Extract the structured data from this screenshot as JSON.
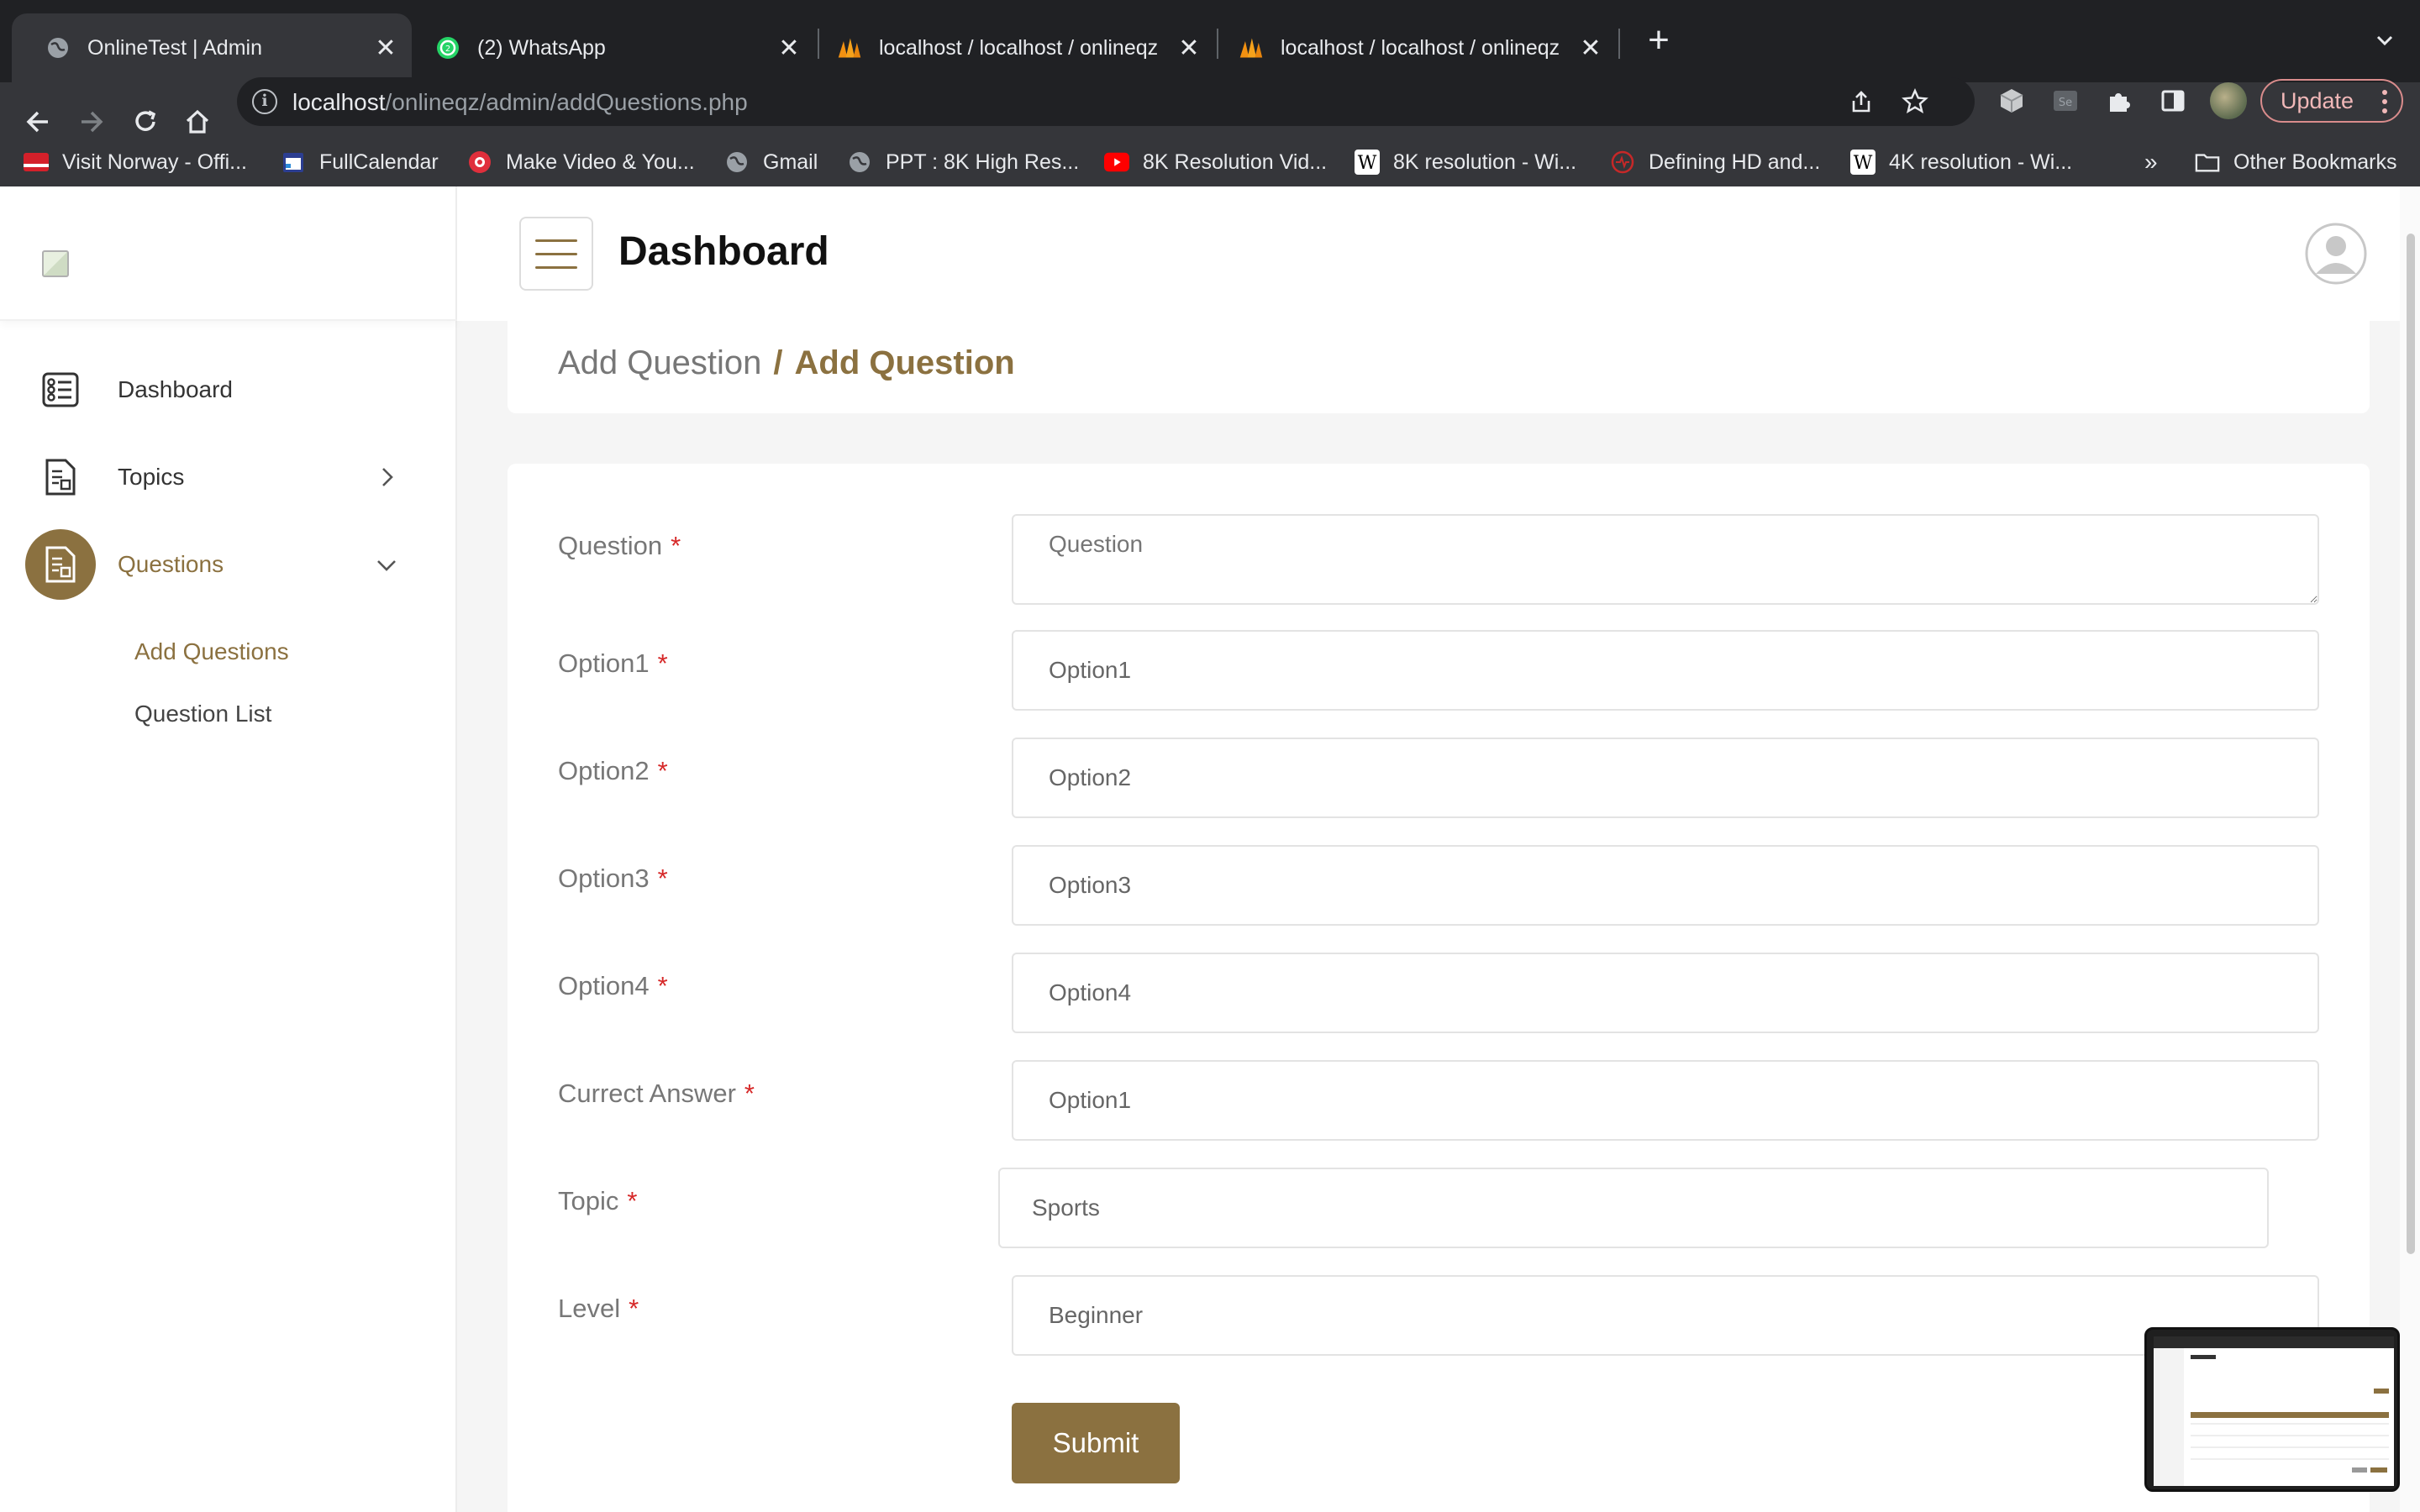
{
  "browser": {
    "tabs": [
      {
        "title": "OnlineTest | Admin",
        "icon": "globe-icon",
        "active": true
      },
      {
        "title": "(2) WhatsApp",
        "icon": "whatsapp-icon",
        "active": false
      },
      {
        "title": "localhost / localhost / onlineqz",
        "icon": "phpmyadmin-icon",
        "active": false
      },
      {
        "title": "localhost / localhost / onlineqz",
        "icon": "phpmyadmin-icon",
        "active": false
      }
    ],
    "url_host": "localhost",
    "url_path": "/onlineqz/admin/addQuestions.php",
    "update_label": "Update",
    "bookmarks": [
      {
        "label": "Visit Norway - Offi...",
        "icon": "norway-flag-icon"
      },
      {
        "label": "FullCalendar",
        "icon": "calendar-icon"
      },
      {
        "label": "Make Video & You...",
        "icon": "video-maker-icon"
      },
      {
        "label": "Gmail",
        "icon": "globe-icon"
      },
      {
        "label": "PPT : 8K High Res...",
        "icon": "globe-icon"
      },
      {
        "label": "8K Resolution Vid...",
        "icon": "youtube-icon"
      },
      {
        "label": "8K resolution - Wi...",
        "icon": "wikipedia-icon"
      },
      {
        "label": "Defining HD and...",
        "icon": "hd-icon"
      },
      {
        "label": "4K resolution - Wi...",
        "icon": "wikipedia-icon"
      }
    ],
    "overflow_label": "»",
    "other_bookmarks_label": "Other Bookmarks"
  },
  "colors": {
    "accent": "#8b7140",
    "required": "#d62828",
    "chrome_dark": "#202124",
    "chrome_toolbar": "#35363a"
  },
  "sidebar": {
    "items": [
      {
        "label": "Dashboard",
        "icon": "dashboard-icon"
      },
      {
        "label": "Topics",
        "icon": "document-icon",
        "chevron": "chevron-right-icon"
      },
      {
        "label": "Questions",
        "icon": "document-icon",
        "chevron": "chevron-down-icon",
        "active": true
      }
    ],
    "subitems": [
      {
        "label": "Add Questions",
        "active": true
      },
      {
        "label": "Question List",
        "active": false
      }
    ]
  },
  "header": {
    "title": "Dashboard"
  },
  "breadcrumb": {
    "parent": "Add Question",
    "separator": "/",
    "current": "Add Question"
  },
  "form": {
    "required_marker": "*",
    "fields": [
      {
        "label": "Question",
        "placeholder": "Question"
      },
      {
        "label": "Option1",
        "placeholder": "Option1"
      },
      {
        "label": "Option2",
        "placeholder": "Option2"
      },
      {
        "label": "Option3",
        "placeholder": "Option3"
      },
      {
        "label": "Option4",
        "placeholder": "Option4"
      },
      {
        "label": "Currect Answer",
        "value": "Option1"
      },
      {
        "label": "Topic",
        "value": "Sports"
      },
      {
        "label": "Level",
        "value": "Beginner"
      }
    ],
    "submit_label": "Submit"
  }
}
